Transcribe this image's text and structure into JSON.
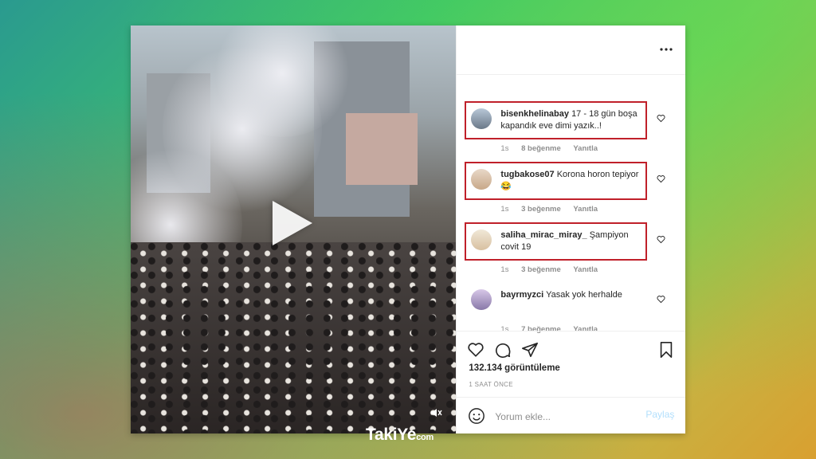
{
  "comments": [
    {
      "user": "bisenkhelinabay",
      "text": "17 - 18 gün boşa kapandık eve dimi yazık..!",
      "time": "1s",
      "likes": "8 beğenme",
      "reply": "Yanıtla",
      "highlighted": true
    },
    {
      "user": "tugbakose07",
      "text": "Korona horon tepiyor 😂",
      "time": "1s",
      "likes": "3 beğenme",
      "reply": "Yanıtla",
      "highlighted": true
    },
    {
      "user": "saliha_mirac_miray_",
      "text": "Şampiyon covit 19",
      "time": "1s",
      "likes": "3 beğenme",
      "reply": "Yanıtla",
      "highlighted": true
    },
    {
      "user": "bayrmyzci",
      "text": "Yasak yok herhalde",
      "time": "1s",
      "likes": "7 beğenme",
      "reply": "Yanıtla",
      "highlighted": false
    }
  ],
  "views": "132.134 görüntüleme",
  "time_ago": "1 SAAT ÖNCE",
  "add_comment": {
    "placeholder": "Yorum ekle...",
    "share_label": "Paylaş"
  },
  "logo": {
    "main": "TakiYe",
    "suffix": "com"
  },
  "icons": [
    "more-icon",
    "heart-icon",
    "comment-icon",
    "share-icon",
    "bookmark-icon",
    "emoji-icon",
    "play-icon",
    "mute-icon"
  ],
  "colors": {
    "highlight": "#c0202a",
    "share_link": "#b2dffc",
    "muted_text": "#8e8e8e"
  }
}
